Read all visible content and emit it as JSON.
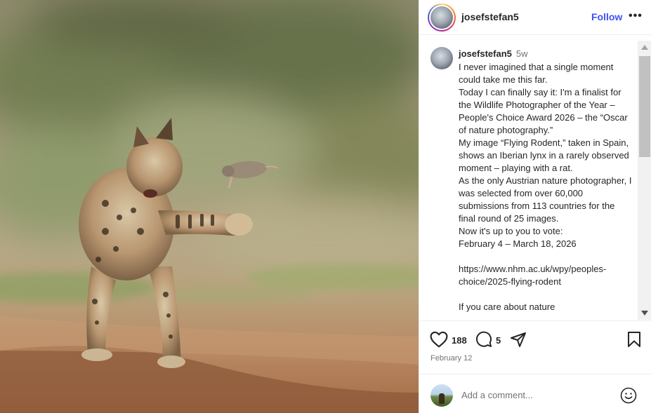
{
  "post": {
    "username": "josefstefan5",
    "follow_label": "Follow",
    "more_label": "•••"
  },
  "caption": {
    "username": "josefstefan5",
    "time_ago": "5w",
    "lines": [
      "I never imagined that a single moment could take me this far.",
      "Today I can finally say it: I'm a finalist for the Wildlife Photographer of the Year – People's Choice Award 2026 – the “Oscar of nature photography.”",
      "My image “Flying Rodent,” taken in Spain, shows an Iberian lynx in a rarely observed moment – playing with a rat.",
      "As the only Austrian nature photographer, I was selected from over 60,000 submissions from 113 countries for the final round of 25 images.",
      "Now it's up to you to vote:",
      "February 4 – March 18, 2026",
      "",
      "https://www.nhm.ac.uk/wpy/peoples-choice/2025-flying-rodent",
      "",
      "If you care about nature"
    ]
  },
  "actions": {
    "likes": "188",
    "comments": "5",
    "date": "February 12"
  },
  "comment_box": {
    "placeholder": "Add a comment..."
  },
  "icons": {
    "like": "heart-icon",
    "comment": "comment-bubble-icon",
    "share": "paper-plane-icon",
    "save": "bookmark-icon",
    "emoji": "emoji-smile-icon"
  },
  "colors": {
    "follow": "#4150f7",
    "text": "#262626",
    "muted": "#737373"
  }
}
